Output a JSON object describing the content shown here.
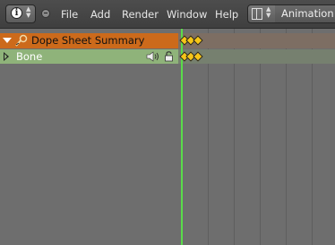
{
  "header": {
    "menus": [
      {
        "id": "file",
        "label": "File"
      },
      {
        "id": "add",
        "label": "Add"
      },
      {
        "id": "render",
        "label": "Render"
      },
      {
        "id": "window",
        "label": "Window"
      },
      {
        "id": "help",
        "label": "Help"
      }
    ],
    "screen_layout": "Animation",
    "editor_type_icon": "info-icon",
    "layout_icon": "screen-layout-icon"
  },
  "channels": {
    "summary": {
      "label": "Dope Sheet Summary",
      "icon": "dopesheet-summary-icon",
      "expanded": true
    },
    "bone": {
      "label": "Bone",
      "expanded": false,
      "icons": [
        "speaker-icon",
        "unlocked-icon"
      ]
    }
  },
  "colors": {
    "summary_row": "#cc6a1b",
    "bone_row": "#8fb37a",
    "playhead": "#5adb4a",
    "keyframe": "#f5c518",
    "background": "#6e6e6e"
  },
  "keyframes": {
    "summary_count": 3,
    "bone_count": 3
  }
}
